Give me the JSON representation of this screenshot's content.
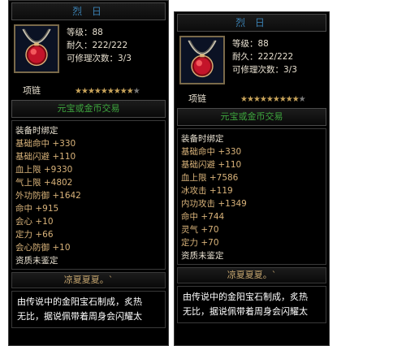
{
  "left": {
    "title": "烈 日",
    "level": "等级：88",
    "durability": "耐久：222/222",
    "repair": "可修理次数：3/3",
    "category": "项链",
    "stars_on": 9,
    "stars_total": 10,
    "trade": "元宝或金币交易",
    "props": [
      "装备时绑定",
      "基础命中 +330",
      "基础闪避 +110",
      "血上限 +9330",
      "气上限 +4802",
      "外功防御 +1642",
      "命中 +915",
      "会心 +10",
      "定力 +66",
      "会心防御 +10",
      "资质未鉴定"
    ],
    "footer": "凉夏夏夏。`",
    "desc_lines": [
      "由传说中的金阳宝石制成，炙热",
      "无比，据说佩带着周身会闪耀太"
    ]
  },
  "right": {
    "title": "烈 日",
    "level": "等级：88",
    "durability": "耐久：222/222",
    "repair": "可修理次数：3/3",
    "category": "项链",
    "stars_on": 9,
    "stars_total": 10,
    "trade": "元宝或金币交易",
    "props": [
      "装备时绑定",
      "基础命中 +330",
      "基础闪避 +110",
      "血上限 +7586",
      "冰攻击 +119",
      "内功攻击 +1349",
      "命中 +744",
      "灵气 +70",
      "定力 +70",
      "资质未鉴定"
    ],
    "footer": "凉夏夏夏。`",
    "desc_lines": [
      "由传说中的金阳宝石制成，炙热",
      "无比，据说佩带着周身会闪耀太"
    ]
  },
  "colors": {
    "title": "#3a7fb0",
    "trade": "#3ea63e",
    "star_on": "#c9a45a",
    "star_off": "#7a7a7a"
  },
  "icons": {
    "item": "ruby-necklace-icon",
    "star": "star-icon"
  }
}
